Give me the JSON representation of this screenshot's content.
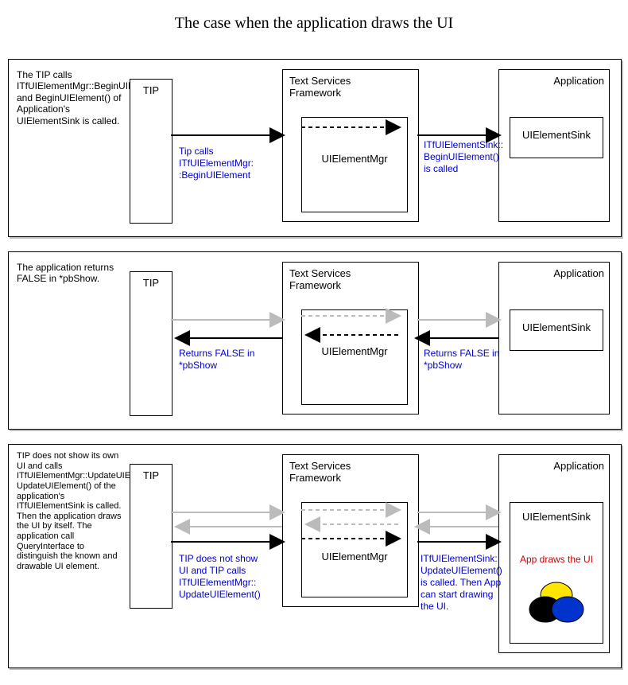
{
  "title": "The case when the application draws the UI",
  "labels": {
    "tip": "TIP",
    "tsf": "Text Services\nFramework",
    "uielementmgr": "UIElementMgr",
    "application": "Application",
    "uielementsink": "UIElementSink",
    "app_draws": "App draws the UI"
  },
  "panels": [
    {
      "desc": "The TIP calls ITfUIElementMgr::BeginUIElement() and BeginUIElement() of Application's UIElementSink is called.",
      "note_left": "Tip calls\nITfUIElementMgr:\n:BeginUIElement",
      "note_right": "ITfUIElementSink::\nBeginUIElement()\nis called"
    },
    {
      "desc": "The application returns FALSE in *pbShow.",
      "note_left": "Returns FALSE in\n*pbShow",
      "note_right": "Returns FALSE in\n*pbShow"
    },
    {
      "desc": "TIP does not show its own UI and calls ITfUIElementMgr::UpdateUIElement(). UpdateUIElement() of the application's ITfUIElementSink is called. Then the application draws the UI by itself. The application call QueryInterface to distinguish the known and drawable UI element.",
      "note_left": "TIP does not show\nUI and TIP calls\nITfUIElementMgr::\nUpdateUIElement()",
      "note_right": "ITfUIElementSink::\nUpdateUIElement()\nis called. Then App\ncan start drawing\nthe UI."
    }
  ]
}
